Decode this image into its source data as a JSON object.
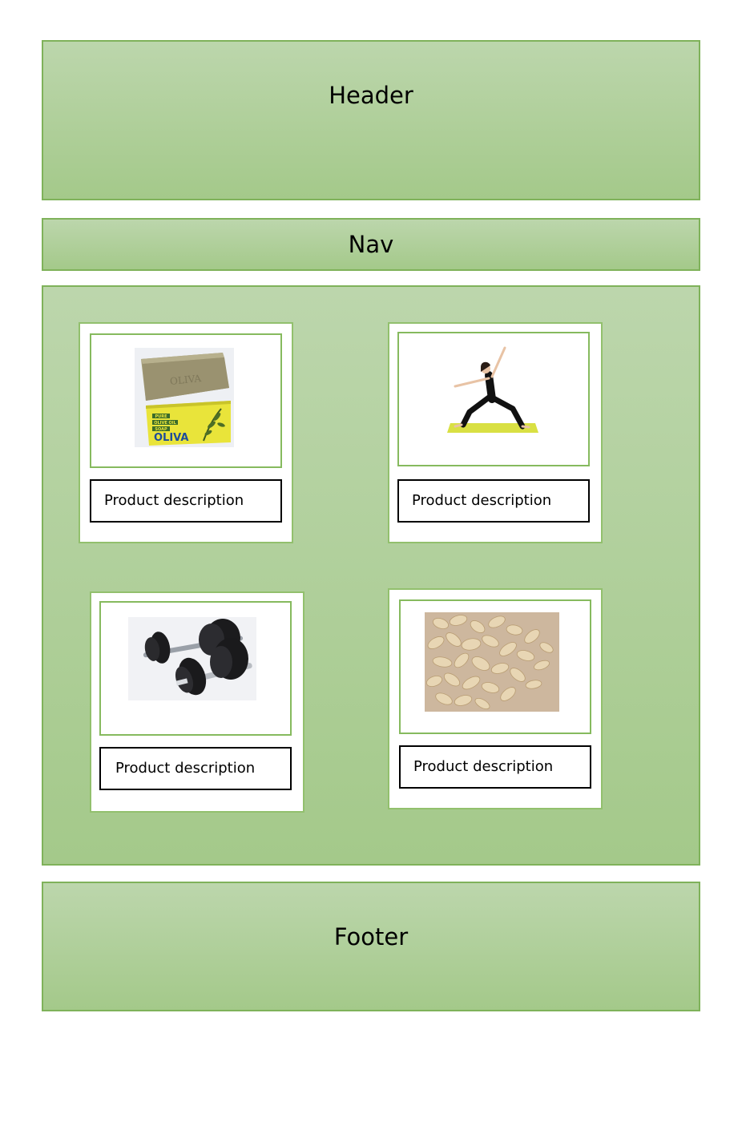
{
  "header": {
    "title": "Header"
  },
  "nav": {
    "title": "Nav"
  },
  "footer": {
    "title": "Footer"
  },
  "products": [
    {
      "image": "olive-oil-soap-image",
      "soap_brand": "OLIVA",
      "soap_box_text": [
        "PURE",
        "OLIVE OIL",
        "SOAP"
      ],
      "description": "Product description"
    },
    {
      "image": "yoga-pose-image",
      "description": "Product description"
    },
    {
      "image": "dumbbells-image",
      "description": "Product description"
    },
    {
      "image": "rolled-oats-image",
      "description": "Product description"
    }
  ],
  "colors": {
    "band_fill_top": "#bcd6ac",
    "band_fill_bottom": "#a4c98a",
    "band_border": "#7fb25a",
    "card_border": "#92c06d"
  }
}
